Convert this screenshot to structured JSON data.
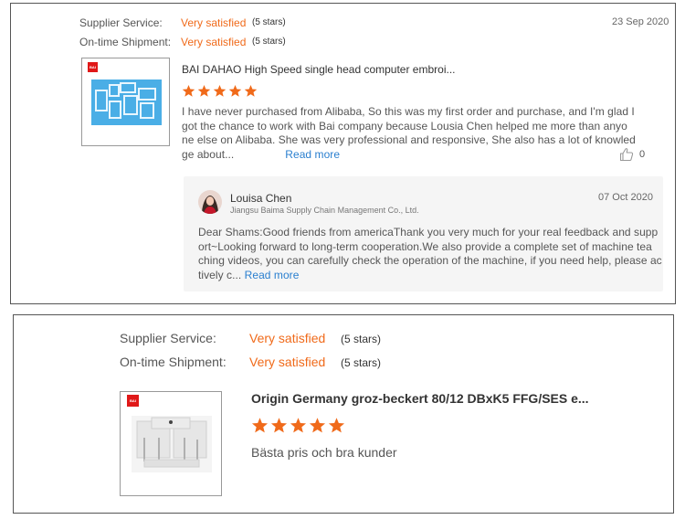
{
  "review1": {
    "supplier_service_label": "Supplier Service:",
    "supplier_service_value": "Very satisfied",
    "supplier_service_stars": "(5 stars)",
    "shipment_label": "On-time Shipment:",
    "shipment_value": "Very satisfied",
    "shipment_stars": "(5 stars)",
    "date": "23 Sep 2020",
    "product_title": "BAI DAHAO High Speed single head computer embroi...",
    "rating": 5,
    "text_lines": [
      "I have never purchased from Alibaba, So this was my first order and purchase, and I'm glad I",
      "got the chance to work with Bai company because Lousia Chen helped me more than anyo",
      "ne else on Alibaba. She was very professional and responsive, She also has a lot of knowled",
      "ge about..."
    ],
    "read_more": "Read more",
    "like_count": "0",
    "reply": {
      "name": "Louisa Chen",
      "company": "Jiangsu Baima Supply Chain Management Co., Ltd.",
      "date": "07 Oct 2020",
      "text_lines": [
        "Dear Shams:Good friends from americaThank you very much for your real feedback and supp",
        "ort~Looking forward to long-term cooperation.We also provide a complete set of machine tea",
        "ching videos, you can carefully check the operation of the machine, if you need help, please ac",
        "tively c..."
      ],
      "read_more": "Read more"
    }
  },
  "review2": {
    "supplier_service_label": "Supplier Service:",
    "supplier_service_value": "Very satisfied",
    "supplier_service_stars": "(5 stars)",
    "shipment_label": "On-time Shipment:",
    "shipment_value": "Very satisfied",
    "shipment_stars": "(5 stars)",
    "product_title": "Origin Germany groz-beckert 80/12 DBxK5 FFG/SES e...",
    "rating": 5,
    "text": "Bästa pris och bra kunder"
  },
  "colors": {
    "accent": "#f06a1a",
    "link": "#2a7fcf",
    "tag": "#e01818",
    "reply_bg": "#f5f5f5"
  },
  "icons": {
    "star": "star-icon",
    "like": "thumbs-up-icon",
    "avatar": "avatar"
  }
}
